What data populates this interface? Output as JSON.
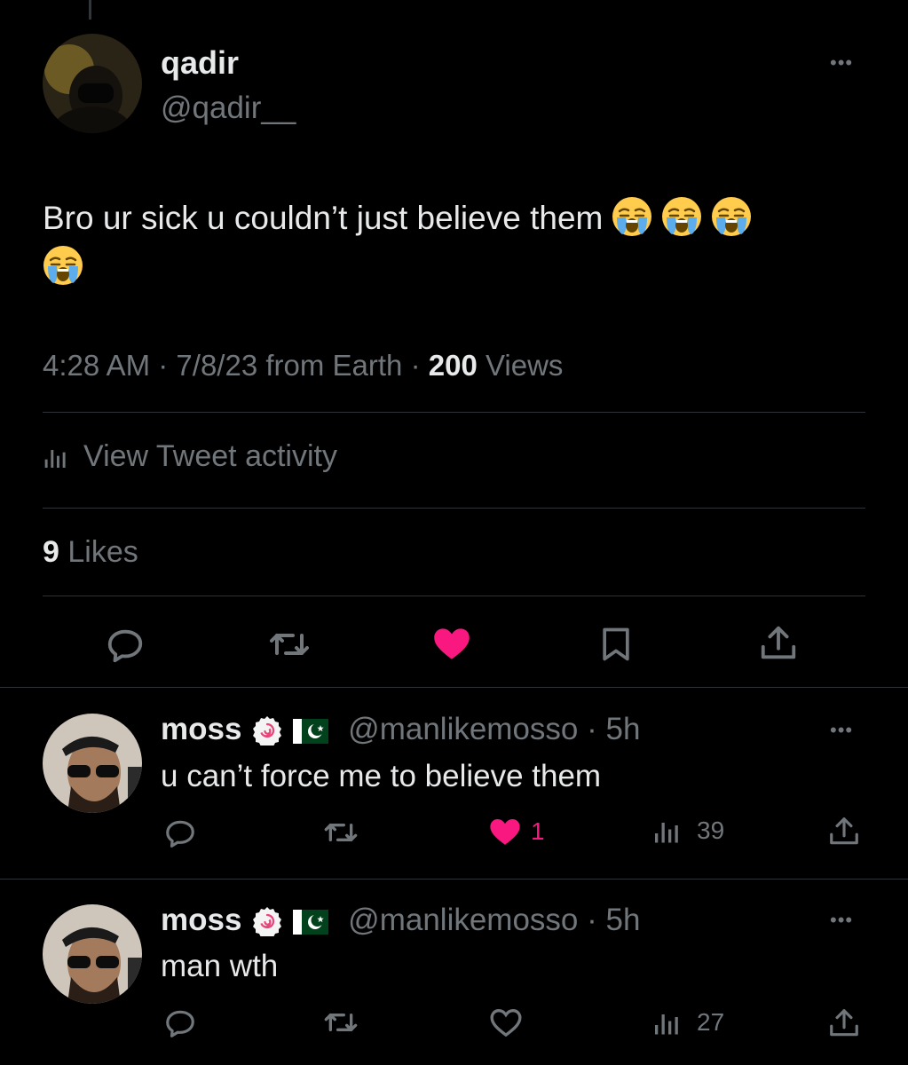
{
  "tweet": {
    "author_name": "qadir",
    "author_handle": "@qadir__",
    "text": "Bro ur sick u couldn’t just believe them",
    "time": "4:28 AM",
    "sep1": "·",
    "date_source": "7/8/23 from Earth",
    "sep2": "·",
    "views_count": "200",
    "views_label": "Views",
    "activity_label": "View Tweet activity",
    "likes_count": "9",
    "likes_label": "Likes",
    "more_label": "•••"
  },
  "replies": [
    {
      "author_name": "moss",
      "handle": "@manlikemosso",
      "time": "· 5h",
      "text": "u can’t force me to believe them",
      "like_count": "1",
      "views": "39",
      "liked": true,
      "more_label": "•••"
    },
    {
      "author_name": "moss",
      "handle": "@manlikemosso",
      "time": "· 5h",
      "text": "man wth",
      "like_count": "",
      "views": "27",
      "liked": false,
      "more_label": "•••"
    }
  ],
  "colors": {
    "background": "#000000",
    "text": "#e7e9ea",
    "muted": "#71767b",
    "like": "#f91880",
    "divider": "#2f3336"
  },
  "icons": [
    "loudly-crying-face-emoji",
    "reply-icon",
    "retweet-icon",
    "heart-icon",
    "bookmark-icon",
    "share-icon",
    "views-icon",
    "fishcake-badge-icon",
    "pakistan-flag-icon",
    "more-icon"
  ]
}
